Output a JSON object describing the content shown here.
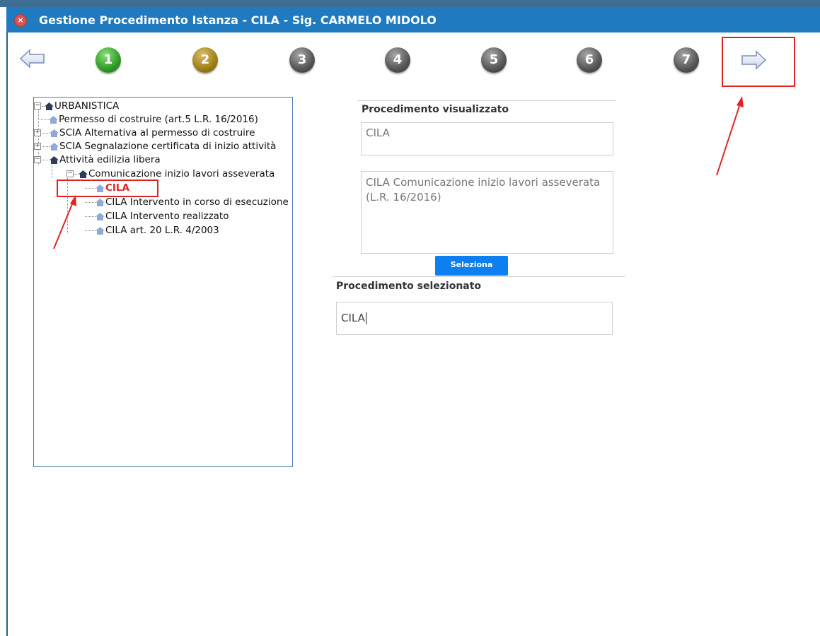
{
  "window": {
    "title": "Gestione Procedimento Istanza - CILA - Sig. CARMELO MIDOLO"
  },
  "wizard": {
    "steps": [
      "1",
      "2",
      "3",
      "4",
      "5",
      "6",
      "7"
    ],
    "current_step": "2"
  },
  "tree": {
    "root": "URBANISTICA",
    "items": [
      "Permesso di costruire (art.5 L.R. 16/2016)",
      "SCIA Alternativa al permesso di costruire",
      "SCIA Segnalazione certificata di inizio attività",
      "Attività edilizia libera",
      "Comunicazione inizio lavori asseverata",
      "CILA",
      "CILA Intervento in corso di esecuzione",
      "CILA Intervento realizzato",
      "CILA art. 20 L.R. 4/2003"
    ],
    "selected": "CILA"
  },
  "detail": {
    "visualized_heading": "Procedimento visualizzato",
    "visualized_code": "CILA",
    "visualized_description": "CILA Comunicazione inizio lavori asseverata (L.R. 16/2016)",
    "select_button": "Seleziona",
    "selected_heading": "Procedimento selezionato",
    "selected_value": "CILA"
  },
  "colors": {
    "titlebar": "#1f7ac0",
    "accent_button": "#0d7ff0",
    "annotation": "#e02424"
  }
}
